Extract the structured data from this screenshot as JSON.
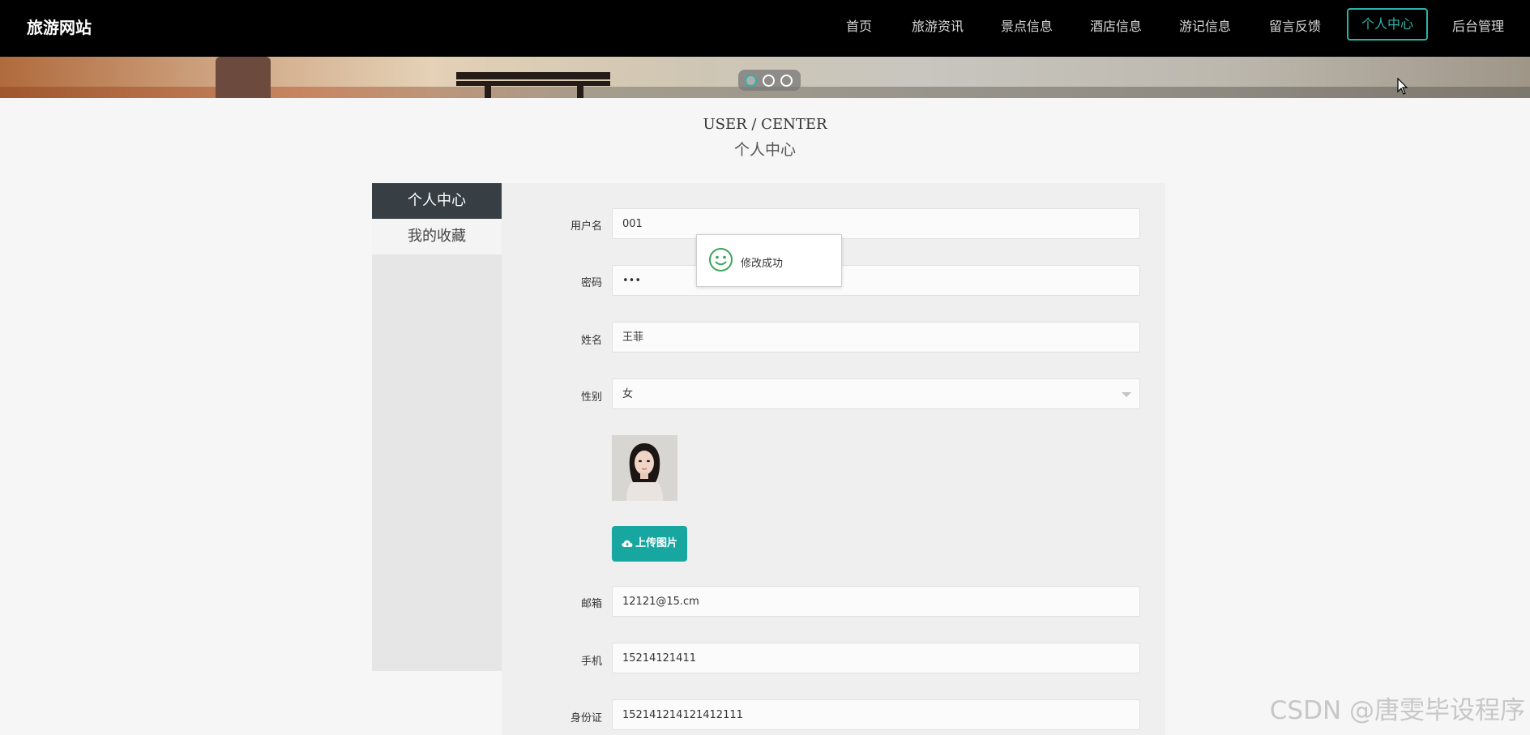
{
  "brand": "旅游网站",
  "nav": {
    "items": [
      {
        "label": "首页"
      },
      {
        "label": "旅游资讯"
      },
      {
        "label": "景点信息"
      },
      {
        "label": "酒店信息"
      },
      {
        "label": "游记信息"
      },
      {
        "label": "留言反馈"
      },
      {
        "label": "个人中心"
      },
      {
        "label": "后台管理"
      }
    ],
    "active_index": 6
  },
  "carousel": {
    "slide_count": 3,
    "active_slide": 1
  },
  "page_title": {
    "en": "USER / CENTER",
    "cn": "个人中心"
  },
  "side_menu": {
    "items": [
      {
        "label": "个人中心"
      },
      {
        "label": "我的收藏"
      }
    ]
  },
  "form": {
    "username_label": "用户名",
    "username_value": "001",
    "password_label": "密码",
    "password_value": "•••",
    "name_label": "姓名",
    "name_value": "王菲",
    "gender_label": "性别",
    "gender_value": "女",
    "upload_button": "上传图片",
    "email_label": "邮箱",
    "email_value": "12121@15.cm",
    "phone_label": "手机",
    "phone_value": "15214121411",
    "idcard_label": "身份证",
    "idcard_value": "152141214121412111"
  },
  "toast": {
    "message": "修改成功",
    "icon": "smile-icon"
  },
  "watermark": "CSDN @唐雯毕设程序",
  "colors": {
    "accent": "#2bb3a9",
    "button": "#17a6a0",
    "nav_bg": "#000000",
    "side_active": "#373f45"
  }
}
